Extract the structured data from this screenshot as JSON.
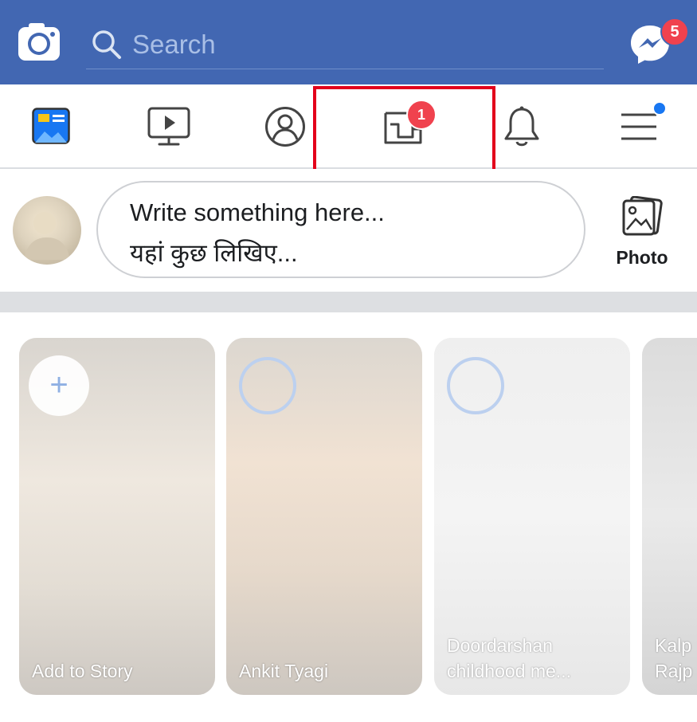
{
  "colors": {
    "brand": "#4267b2",
    "badge": "#f0424e",
    "highlight": "#e3001b",
    "accent": "#1877f2"
  },
  "header": {
    "camera_icon": "camera-icon",
    "search_placeholder": "Search",
    "messenger_icon": "messenger-icon",
    "messenger_badge": "5"
  },
  "nav": {
    "items": [
      {
        "name": "news-feed",
        "icon": "news-feed-icon"
      },
      {
        "name": "watch",
        "icon": "video-icon"
      },
      {
        "name": "profile",
        "icon": "profile-icon"
      },
      {
        "name": "pages",
        "icon": "pages-flag-icon",
        "badge": "1"
      },
      {
        "name": "notifications",
        "icon": "bell-icon"
      },
      {
        "name": "menu",
        "icon": "hamburger-menu-icon"
      }
    ]
  },
  "composer": {
    "line1": "Write something here...",
    "line2": "यहां कुछ लिखिए...",
    "photo_label": "Photo"
  },
  "stories": [
    {
      "caption": "Add to Story"
    },
    {
      "caption": "Ankit Tyagi"
    },
    {
      "caption": "Doordarshan childhood me..."
    },
    {
      "caption": "Kalp Rajp"
    }
  ]
}
